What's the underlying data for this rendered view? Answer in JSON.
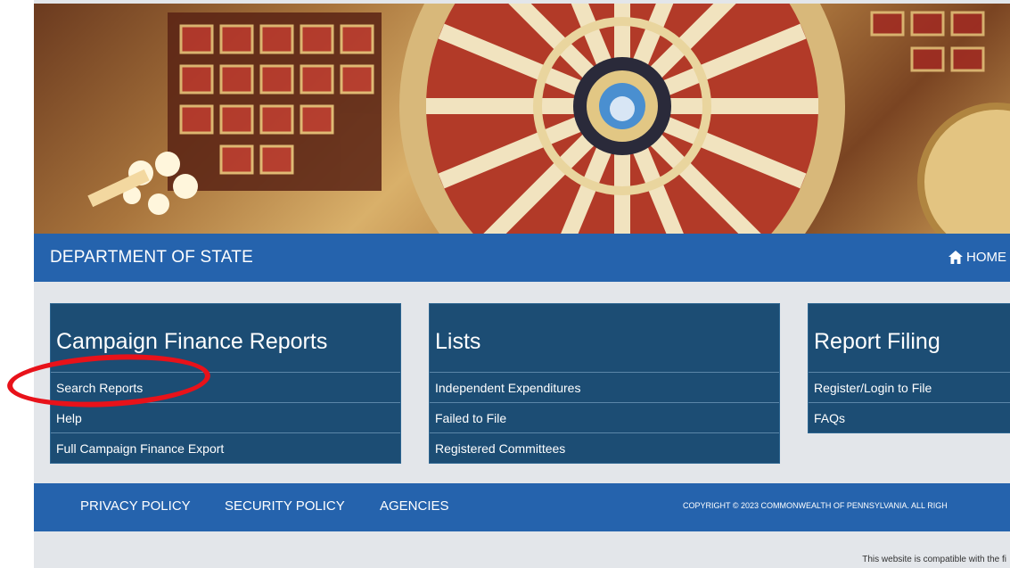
{
  "header": {
    "title": "DEPARTMENT OF STATE",
    "home_label": "HOME"
  },
  "panels": {
    "campaign_finance": {
      "title": "Campaign Finance Reports",
      "items": [
        "Search Reports",
        "Help",
        "Full Campaign Finance Export"
      ]
    },
    "lists": {
      "title": "Lists",
      "items": [
        "Independent Expenditures",
        "Failed to File",
        "Registered Committees"
      ]
    },
    "report_filing": {
      "title": "Report Filing",
      "items": [
        "Register/Login to File",
        "FAQs"
      ]
    }
  },
  "footer": {
    "links": [
      "PRIVACY POLICY",
      "SECURITY POLICY",
      "AGENCIES"
    ],
    "copyright": "COPYRIGHT © 2023 COMMONWEALTH OF PENNSYLVANIA. ALL RIGH",
    "compat_note": "This website is compatible with the fi"
  },
  "colors": {
    "header_blue": "#2563ad",
    "panel_navy": "#1c4d74",
    "annotation_red": "#e8121a"
  }
}
